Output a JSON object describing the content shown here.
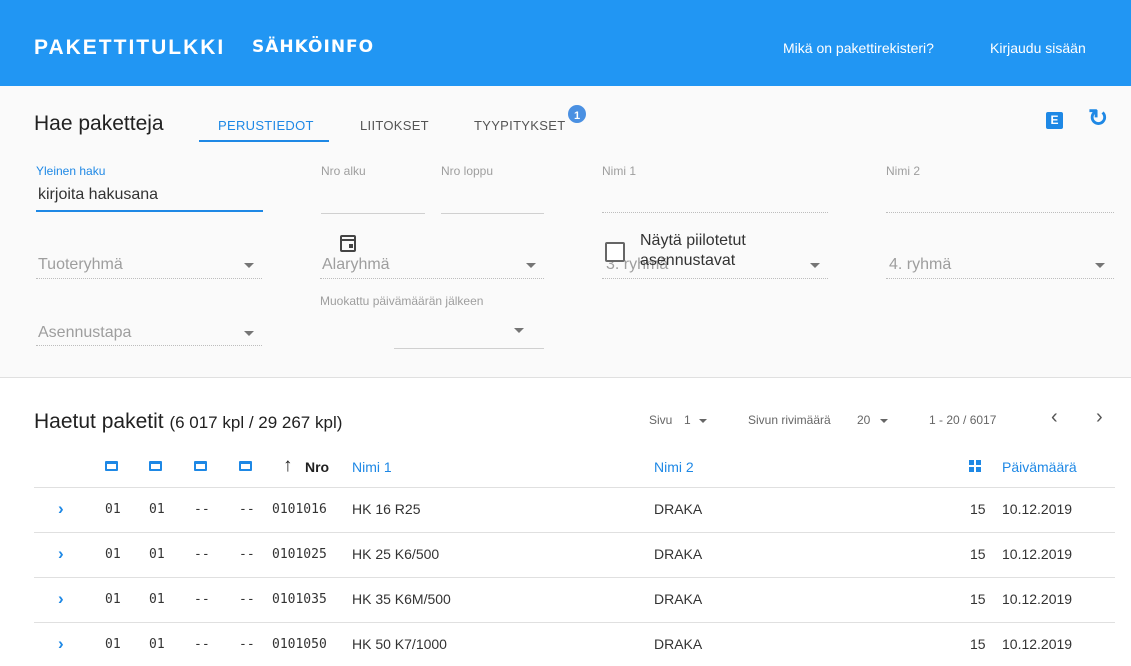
{
  "appbar": {
    "title": "PAKETTITULKKI",
    "brand": "SÄHKÖINFO",
    "links": [
      "Mikä on pakettirekisteri?",
      "Kirjaudu sisään"
    ]
  },
  "search": {
    "title": "Hae paketteja",
    "tabs": [
      {
        "label": "PERUSTIEDOT",
        "active": true
      },
      {
        "label": "LIITOKSET",
        "active": false
      },
      {
        "label": "TYYPITYKSET",
        "active": false
      }
    ],
    "tab_badge": "1",
    "export_icon_label": "E",
    "fields": {
      "general_label": "Yleinen haku",
      "general_value": "kirjoita hakusana",
      "nro_start_label": "Nro alku",
      "nro_end_label": "Nro loppu",
      "name1_label": "Nimi 1",
      "name2_label": "Nimi 2"
    },
    "selects": {
      "product_group": "Tuoteryhmä",
      "subgroup": "Alaryhmä",
      "group3": "3. ryhmä",
      "group4": "4. ryhmä",
      "install_method": "Asennustapa"
    },
    "modified_after_label": "Muokattu päivämäärän jälkeen",
    "show_hidden_label": "Näytä piilotetut asennustavat"
  },
  "results": {
    "title": "Haetut paketit",
    "count": "(6 017 kpl / 29 267 kpl)",
    "page_label": "Sivu",
    "page_value": "1",
    "rows_label": "Sivun rivimäärä",
    "rows_value": "20",
    "range": "1 - 20 / 6017",
    "columns": {
      "nro": "Nro",
      "name1": "Nimi 1",
      "name2": "Nimi 2",
      "date": "Päivämäärä"
    },
    "rows": [
      {
        "g1": "01",
        "g2": "01",
        "g3": "--",
        "g4": "--",
        "nro": "0101016",
        "name1": "HK 16 R25",
        "name2": "DRAKA",
        "count": "15",
        "date": "10.12.2019"
      },
      {
        "g1": "01",
        "g2": "01",
        "g3": "--",
        "g4": "--",
        "nro": "0101025",
        "name1": "HK 25 K6/500",
        "name2": "DRAKA",
        "count": "15",
        "date": "10.12.2019"
      },
      {
        "g1": "01",
        "g2": "01",
        "g3": "--",
        "g4": "--",
        "nro": "0101035",
        "name1": "HK 35 K6M/500",
        "name2": "DRAKA",
        "count": "15",
        "date": "10.12.2019"
      },
      {
        "g1": "01",
        "g2": "01",
        "g3": "--",
        "g4": "--",
        "nro": "0101050",
        "name1": "HK 50 K7/1000",
        "name2": "DRAKA",
        "count": "15",
        "date": "10.12.2019"
      }
    ]
  },
  "colors": {
    "primary": "#2196f3",
    "accent": "#1e88e5",
    "badge": "#4a90e2"
  }
}
